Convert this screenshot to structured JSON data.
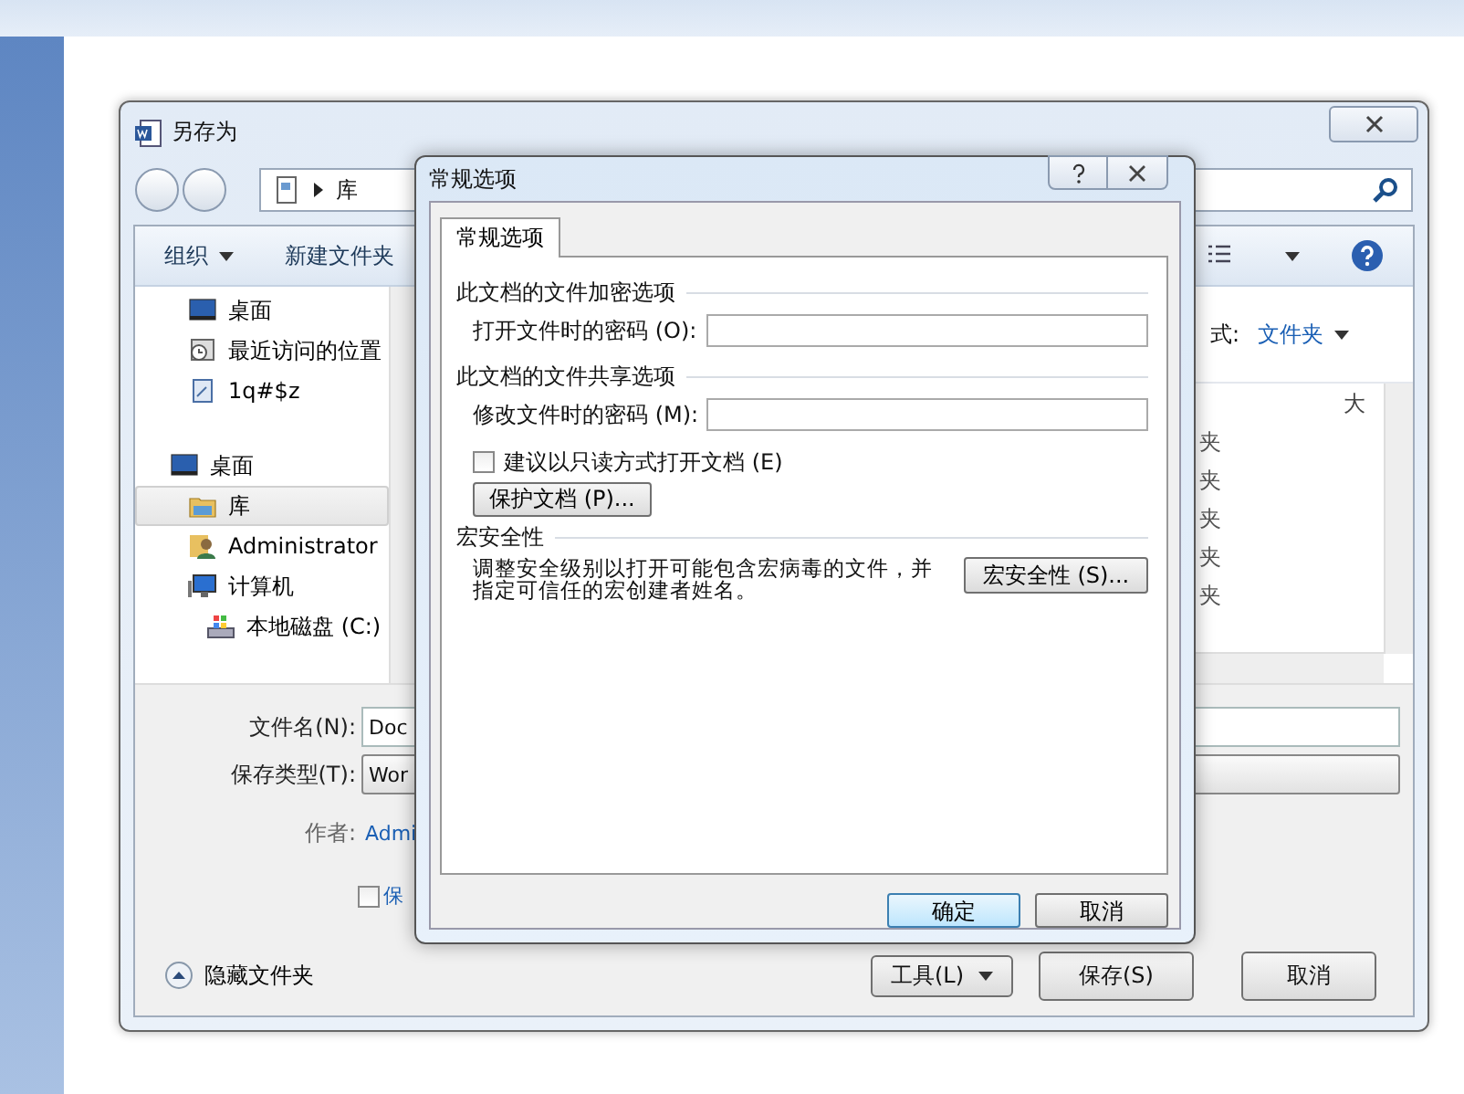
{
  "save_dialog": {
    "title": "另存为",
    "address": {
      "crumbs": [
        "库"
      ]
    },
    "toolbar": {
      "organize": "组织",
      "new_folder": "新建文件夹"
    },
    "favorites": [
      {
        "label": "桌面",
        "kind": "desktop"
      },
      {
        "label": "最近访问的位置",
        "kind": "recent"
      },
      {
        "label": "1q#$z",
        "kind": "link"
      }
    ],
    "tree": [
      {
        "label": "桌面",
        "kind": "desktop",
        "selected": false,
        "children": [
          {
            "label": "库",
            "kind": "library",
            "selected": true
          },
          {
            "label": "Administrator",
            "kind": "user",
            "selected": false
          },
          {
            "label": "计算机",
            "kind": "computer",
            "selected": false,
            "children": [
              {
                "label": "本地磁盘 (C:)",
                "kind": "drive",
                "selected": false
              }
            ]
          }
        ]
      }
    ],
    "arrange": {
      "label": "式:",
      "value": "文件夹"
    },
    "file_list": {
      "column_1": "大",
      "items": [
        "夹",
        "夹",
        "夹",
        "夹",
        "夹"
      ]
    },
    "file_name": {
      "label": "文件名(N):",
      "value": "Doc"
    },
    "file_type": {
      "label": "保存类型(T):",
      "value": "Wor"
    },
    "author": {
      "label": "作者:",
      "value": "Admi"
    },
    "thumbnail": {
      "label": "保",
      "checked": false
    },
    "hide_folders": "隐藏文件夹",
    "tools": "工具(L)",
    "save": "保存(S)",
    "cancel": "取消"
  },
  "options_dialog": {
    "title": "常规选项",
    "tabs": [
      {
        "label": "常规选项",
        "selected": true
      }
    ],
    "encryption": {
      "heading": "此文档的文件加密选项",
      "label": "打开文件时的密码 (O):"
    },
    "sharing": {
      "heading": "此文档的文件共享选项",
      "label": "修改文件时的密码 (M):"
    },
    "read_only": {
      "label": "建议以只读方式打开文档 (E)",
      "checked": false
    },
    "protect": "保护文档 (P)...",
    "macro": {
      "heading": "宏安全性",
      "text_lines": [
        "调整安全级别以打开可能包含宏病毒的文件，并",
        "指定可信任的宏创建者姓名。"
      ],
      "button": "宏安全性 (S)..."
    },
    "ok": "确定",
    "cancel": "取消"
  }
}
